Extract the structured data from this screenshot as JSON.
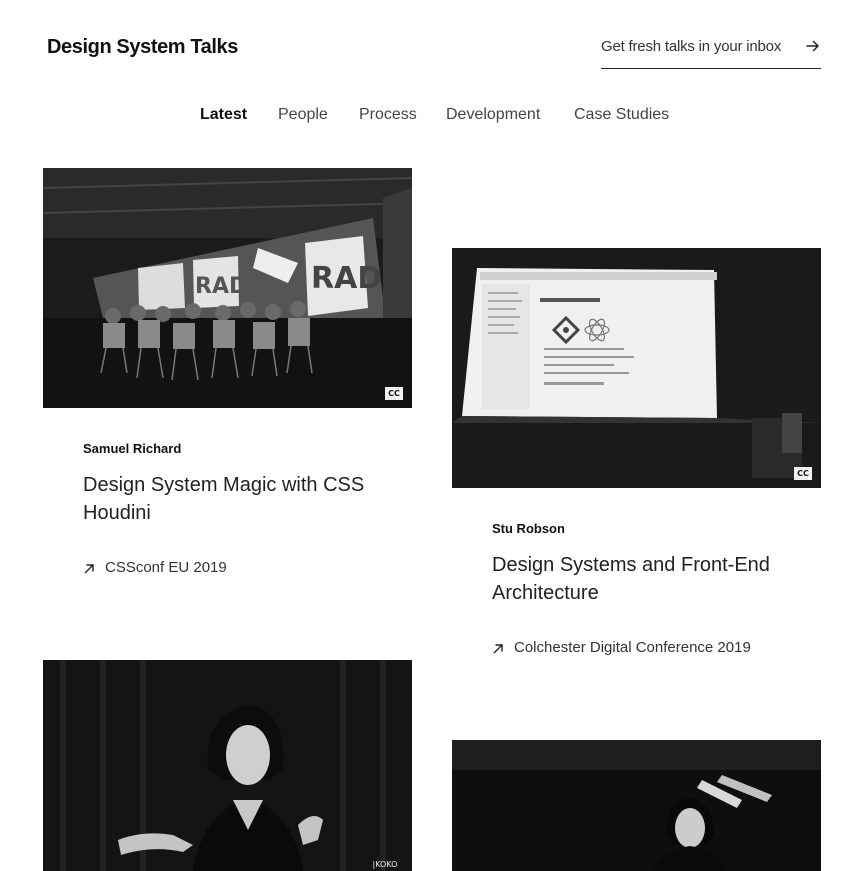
{
  "header": {
    "site_title": "Design System Talks",
    "subscribe_label": "Get fresh talks in your inbox",
    "subscribe_icon": "arrow-right-icon"
  },
  "nav": {
    "tabs": [
      {
        "label": "Latest",
        "active": true
      },
      {
        "label": "People",
        "active": false
      },
      {
        "label": "Process",
        "active": false
      },
      {
        "label": "Development",
        "active": false
      },
      {
        "label": "Case Studies",
        "active": false
      }
    ]
  },
  "talks": [
    {
      "speaker": "Samuel Richard",
      "title": "Design System Magic with CSS Houdini",
      "event": "CSSconf EU 2019",
      "event_icon": "arrow-up-right-icon",
      "image_badge": "CC"
    },
    {
      "speaker": "Stu Robson",
      "title": "Design Systems and Front-End Architecture",
      "event": "Colchester Digital Conference 2019",
      "event_icon": "arrow-up-right-icon",
      "image_badge": "CC"
    },
    {
      "image_badge": "|KOKO"
    },
    {}
  ]
}
